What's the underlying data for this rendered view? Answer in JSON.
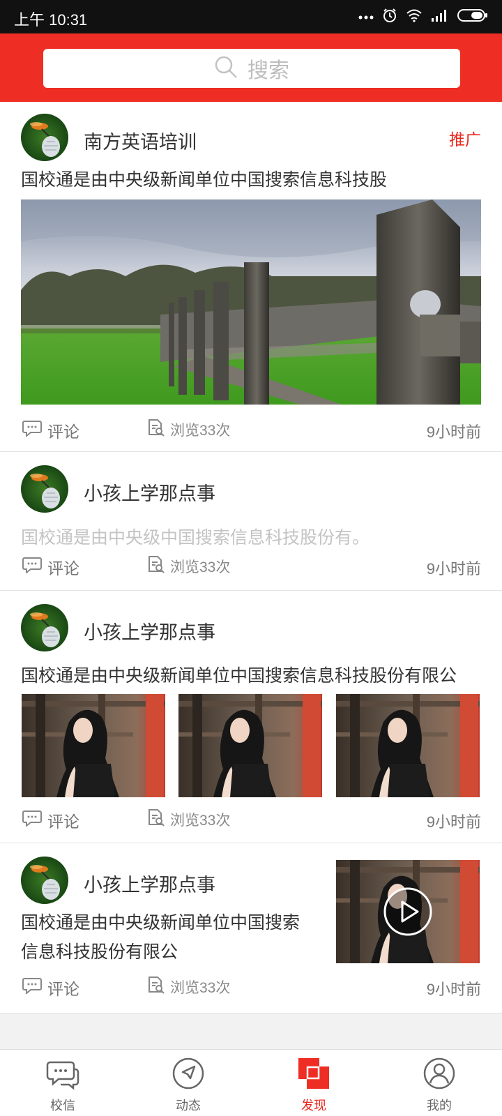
{
  "status_bar": {
    "time": "上午 10:31"
  },
  "search": {
    "placeholder": "搜索"
  },
  "feed": {
    "items": [
      {
        "author": "南方英语培训",
        "tag": "推广",
        "title": "国校通是由中央级新闻单位中国搜索信息科技股",
        "comment_label": "评论",
        "views_label": "浏览33次",
        "time": "9小时前"
      },
      {
        "author": "小孩上学那点事",
        "title": "国校通是由中央级中国搜索信息科技股份有。",
        "comment_label": "评论",
        "views_label": "浏览33次",
        "time": "9小时前"
      },
      {
        "author": "小孩上学那点事",
        "title": "国校通是由中央级新闻单位中国搜索信息科技股份有限公",
        "comment_label": "评论",
        "views_label": "浏览33次",
        "time": "9小时前"
      },
      {
        "author": "小孩上学那点事",
        "title_line1": "国校通是由中央级新闻单位中国搜索",
        "title_line2": "信息科技股份有限公",
        "comment_label": "评论",
        "views_label": "浏览33次",
        "time": "9小时前"
      }
    ]
  },
  "tabbar": {
    "tabs": [
      {
        "label": "校信",
        "icon": "chat-icon"
      },
      {
        "label": "动态",
        "icon": "compass-icon"
      },
      {
        "label": "发现",
        "icon": "discover-icon",
        "active": true
      },
      {
        "label": "我的",
        "icon": "profile-icon"
      }
    ]
  },
  "colors": {
    "brand": "#ee2e24",
    "promo_tag": "#e8281e",
    "background": "#f2f2f2"
  }
}
